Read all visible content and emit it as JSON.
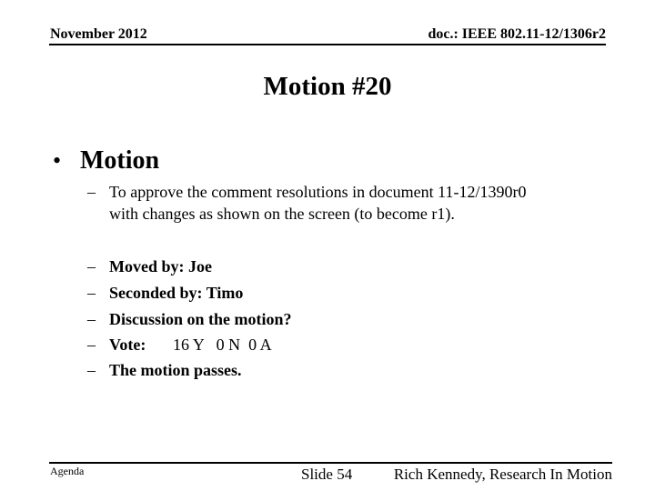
{
  "header": {
    "date": "November 2012",
    "doc_id": "doc.: IEEE 802.11-12/1306r2"
  },
  "slide": {
    "title": "Motion #20",
    "bullet": {
      "symbol": "•",
      "text": "Motion"
    },
    "description": {
      "dash": "–",
      "lines": [
        "To approve the comment resolutions in document 11-12/1390r0",
        "with changes as shown on the screen (to become r1)."
      ]
    },
    "items": [
      {
        "dash": "–",
        "text": "Moved by: Joe"
      },
      {
        "dash": "–",
        "text": "Seconded by: Timo"
      },
      {
        "dash": "–",
        "text": "Discussion on the motion?"
      },
      {
        "dash": "–",
        "label": "Vote:",
        "value": "16 Y   0 N  0 A"
      },
      {
        "dash": "–",
        "text": "The motion passes."
      }
    ]
  },
  "footer": {
    "section": "Agenda",
    "slide_number": "Slide 54",
    "author": "Rich Kennedy, Research In Motion"
  }
}
